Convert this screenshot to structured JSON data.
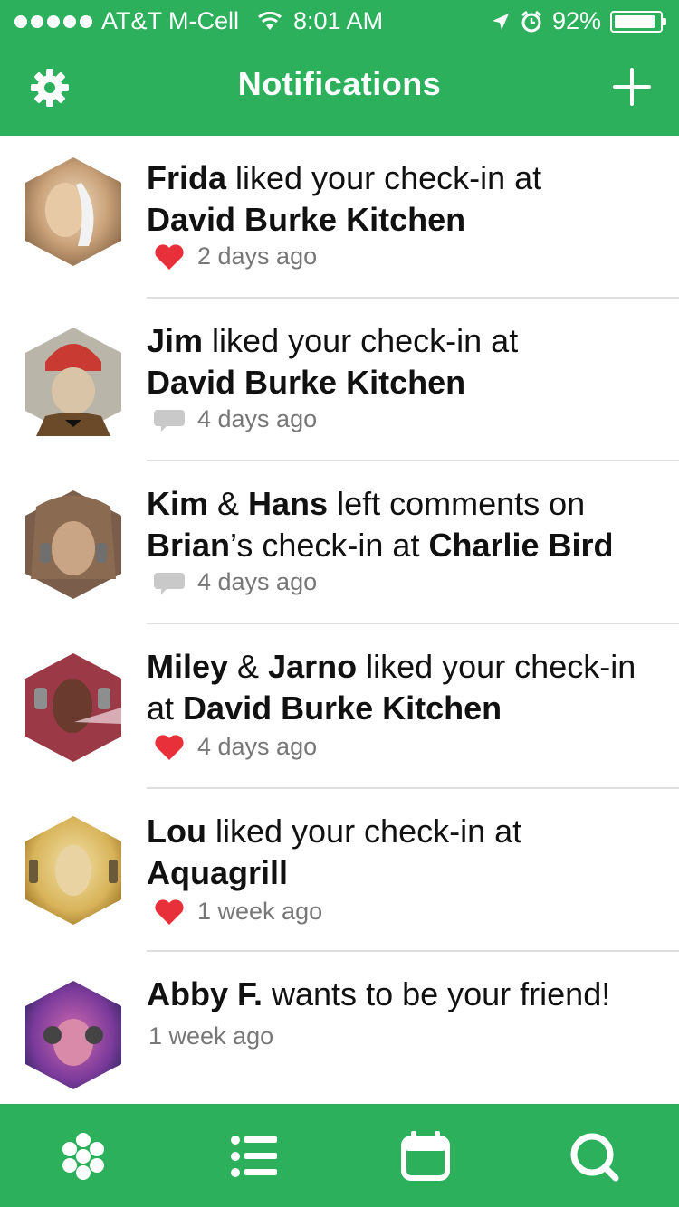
{
  "status_bar": {
    "carrier": "AT&T M-Cell",
    "time": "8:01 AM",
    "battery": "92%",
    "battery_level": 0.92
  },
  "header": {
    "title": "Notifications",
    "left_icon": "gear-icon",
    "right_icon": "plus-icon"
  },
  "notifications": [
    {
      "name1": "Frida",
      "text1": " liked your check-in at",
      "line2": "David Burke Kitchen",
      "meta_icon": "heart-icon",
      "time": "2 days ago"
    },
    {
      "name1": "Jim",
      "text1": " liked your check-in at",
      "line2": "David Burke Kitchen",
      "meta_icon": "comment-icon",
      "time": "4 days ago"
    },
    {
      "name1": "Kim",
      "amp": " & ",
      "name2": "Hans",
      "text1": " left comments on",
      "line2_name": "Brian",
      "line2_mid": "’s check-in at ",
      "line2_place": "Charlie Bird",
      "meta_icon": "comment-icon",
      "time": "4 days ago"
    },
    {
      "name1": "Miley",
      "amp": " & ",
      "name2": "Jarno",
      "text1": " liked your check-in",
      "line2_pre": "at ",
      "line2_place": "David Burke Kitchen",
      "meta_icon": "heart-icon",
      "time": "4 days ago"
    },
    {
      "name1": "Lou",
      "text1": " liked your check-in at",
      "line2": "Aquagrill",
      "meta_icon": "heart-icon",
      "time": "1 week ago"
    },
    {
      "name1": "Abby F.",
      "text1": " wants to be your friend!",
      "time": "1 week ago"
    }
  ],
  "tab_bar": {
    "items": [
      "honeycomb-icon",
      "list-icon",
      "calendar-icon",
      "search-icon"
    ]
  },
  "colors": {
    "brand_green": "#2cb05c",
    "heart_red": "#e8303a",
    "comment_gray": "#c9c9c9"
  }
}
